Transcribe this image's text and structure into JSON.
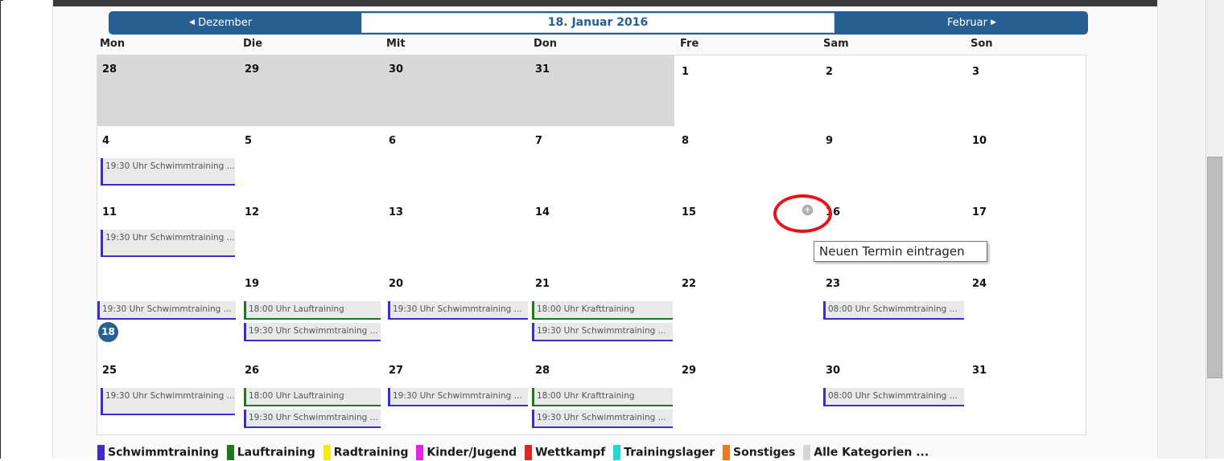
{
  "nav": {
    "prev_label": "Dezember",
    "next_label": "Februar",
    "title": "18. Januar 2016"
  },
  "weekdays": [
    "Mon",
    "Die",
    "Mit",
    "Don",
    "Fre",
    "Sam",
    "Son"
  ],
  "weeks": [
    [
      "28",
      "29",
      "30",
      "31",
      "1",
      "2",
      "3"
    ],
    [
      "4",
      "5",
      "6",
      "7",
      "8",
      "9",
      "10"
    ],
    [
      "11",
      "12",
      "13",
      "14",
      "15",
      "16",
      "17"
    ],
    [
      "18",
      "19",
      "20",
      "21",
      "22",
      "23",
      "24"
    ],
    [
      "25",
      "26",
      "27",
      "28",
      "29",
      "30",
      "31"
    ]
  ],
  "events": {
    "w2_mon": "19:30 Uhr Schwimmtraining ...",
    "w3_mon": "19:30 Uhr Schwimmtraining ...",
    "w4_mon": "19:30 Uhr Schwimmtraining ...",
    "w4_die_1": "18:00 Uhr Lauftraining",
    "w4_die_2": "19:30 Uhr Schwimmtraining ...",
    "w4_mit": "19:30 Uhr Schwimmtraining ...",
    "w4_don_1": "18:00 Uhr Krafttraining",
    "w4_don_2": "19:30 Uhr Schwimmtraining ...",
    "w4_sam": "08:00 Uhr Schwimmtraining ...",
    "w5_mon": "19:30 Uhr Schwimmtraining ...",
    "w5_die_1": "18:00 Uhr Lauftraining",
    "w5_die_2": "19:30 Uhr Schwimmtraining ...",
    "w5_mit": "19:30 Uhr Schwimmtraining ...",
    "w5_don_1": "18:00 Uhr Krafttraining",
    "w5_don_2": "19:30 Uhr Schwimmtraining ...",
    "w5_sam": "08:00 Uhr Schwimmtraining ..."
  },
  "tooltip": "Neuen Termin eintragen",
  "legend": [
    {
      "label": "Schwimmtraining",
      "color": "#3b2bd0"
    },
    {
      "label": "Lauftraining",
      "color": "#1c7a1c"
    },
    {
      "label": "Radtraining",
      "color": "#f2e81a"
    },
    {
      "label": "Kinder/Jugend",
      "color": "#ee20e8"
    },
    {
      "label": "Wettkampf",
      "color": "#e52520"
    },
    {
      "label": "Trainingslager",
      "color": "#21d8d8"
    },
    {
      "label": "Sonstiges",
      "color": "#ea7a1c"
    },
    {
      "label": "Alle Kategorien ...",
      "color": "#d6d6d6"
    }
  ]
}
